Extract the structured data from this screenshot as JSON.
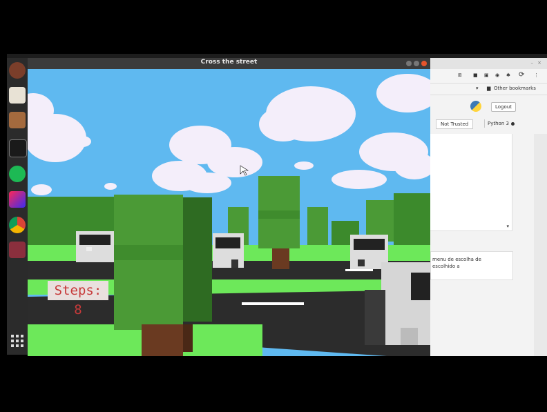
{
  "game": {
    "title": "Cross the street",
    "steps_text": "Steps: 8",
    "colors": {
      "sky": "#5fb9f0",
      "grass": "#6de85a",
      "road": "#2c2c2c",
      "tree_light": "#4b9a36",
      "tree_dark": "#2e6b22",
      "trunk": "#6a3a21"
    }
  },
  "dock": {
    "icons": [
      "firefox-icon",
      "text-editor-icon",
      "files-icon",
      "terminal-icon",
      "spotify-icon",
      "intellij-icon",
      "chrome-icon",
      "window-icon",
      "apps-grid-icon"
    ]
  },
  "browser": {
    "bookmarks_label": "Other bookmarks",
    "logout_label": "Logout",
    "not_trusted_label": "Not Trusted",
    "kernel_label": "Python 3",
    "text_line1": "menu de escolha de",
    "text_line2": "escolhido a"
  }
}
